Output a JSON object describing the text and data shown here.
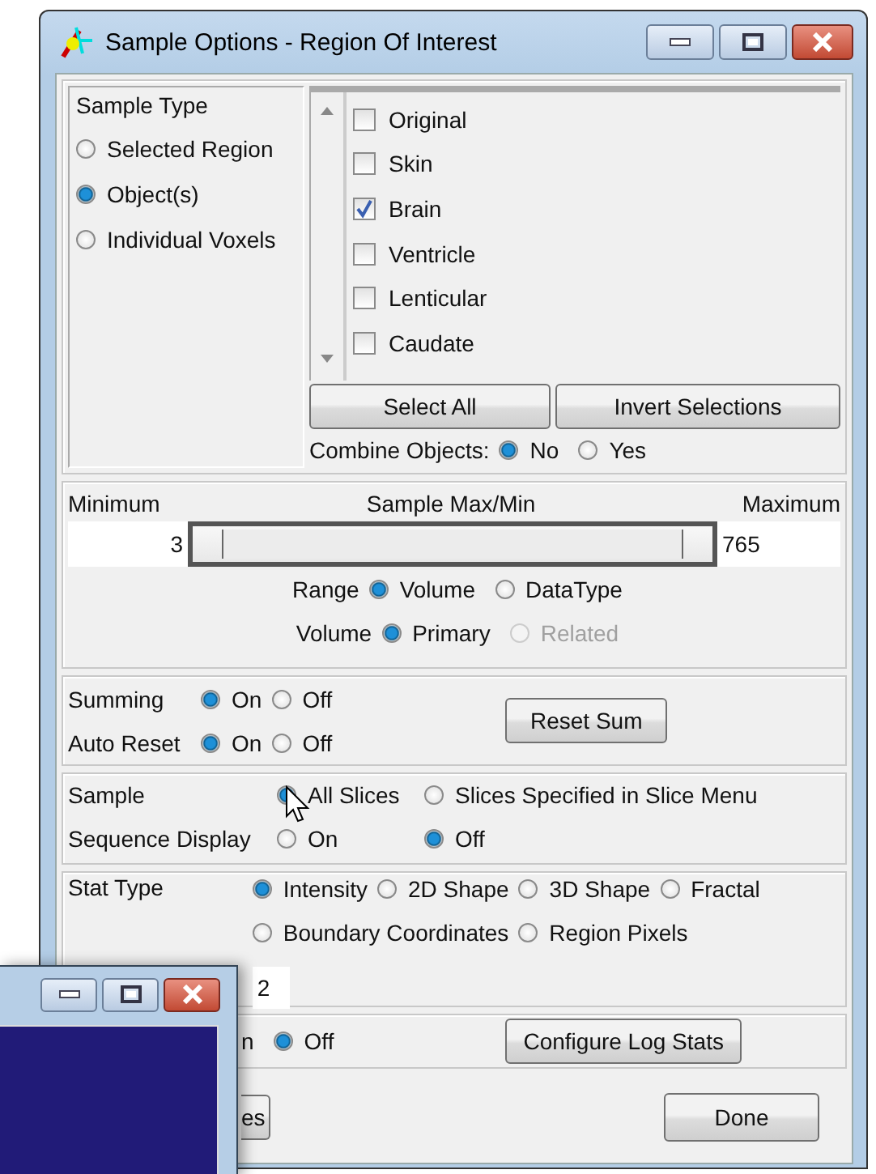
{
  "window": {
    "title": "Sample Options - Region Of Interest"
  },
  "sample_type": {
    "title": "Sample Type",
    "options": [
      {
        "label": "Selected Region",
        "selected": false
      },
      {
        "label": "Object(s)",
        "selected": true
      },
      {
        "label": "Individual Voxels",
        "selected": false
      }
    ]
  },
  "objects": {
    "items": [
      {
        "label": "Original",
        "checked": false
      },
      {
        "label": "Skin",
        "checked": false
      },
      {
        "label": "Brain",
        "checked": true
      },
      {
        "label": "Ventricle",
        "checked": false
      },
      {
        "label": "Lenticular",
        "checked": false
      },
      {
        "label": "Caudate",
        "checked": false
      }
    ],
    "buttons": [
      "Select All",
      "Invert Selections"
    ],
    "combine": {
      "label": "Combine Objects:",
      "options": [
        {
          "label": "No",
          "selected": true
        },
        {
          "label": "Yes",
          "selected": false
        }
      ]
    }
  },
  "range_panel": {
    "minimum_label": "Minimum",
    "title": "Sample Max/Min",
    "maximum_label": "Maximum",
    "minimum": "3",
    "maximum": "765",
    "slider": {
      "level": 1
    },
    "rows": [
      {
        "label": "Range",
        "options": [
          {
            "label": "Volume",
            "selected": true,
            "disabled": false
          },
          {
            "label": "DataType",
            "selected": false,
            "disabled": false
          }
        ]
      },
      {
        "label": "Volume",
        "options": [
          {
            "label": "Primary",
            "selected": true,
            "disabled": false
          },
          {
            "label": "Related",
            "selected": false,
            "disabled": true
          }
        ]
      }
    ]
  },
  "summing": {
    "rows": [
      {
        "label": "Summing",
        "options": [
          {
            "label": "On",
            "selected": true
          },
          {
            "label": "Off",
            "selected": false
          }
        ]
      },
      {
        "label": "Auto Reset",
        "options": [
          {
            "label": "On",
            "selected": true
          },
          {
            "label": "Off",
            "selected": false
          }
        ]
      }
    ],
    "button": "Reset Sum"
  },
  "sample": {
    "rows": [
      {
        "label": "Sample",
        "options": [
          {
            "label": "All Slices",
            "selected": true
          },
          {
            "label": "Slices Specified in Slice Menu",
            "selected": false
          }
        ]
      },
      {
        "label": "Sequence Display",
        "options": [
          {
            "label": "On",
            "selected": false
          },
          {
            "label": "Off",
            "selected": true
          }
        ]
      }
    ]
  },
  "stat_type": {
    "label": "Stat Type",
    "options": [
      {
        "label": "Intensity",
        "selected": true
      },
      {
        "label": "2D Shape",
        "selected": false
      },
      {
        "label": "3D Shape",
        "selected": false
      },
      {
        "label": "Fractal",
        "selected": false
      },
      {
        "label": "Boundary Coordinates",
        "selected": false
      },
      {
        "label": "Region Pixels",
        "selected": false
      }
    ],
    "value": "2"
  },
  "log": {
    "partial_label": "n",
    "options": [
      {
        "label": "Off",
        "selected": true
      }
    ],
    "button": "Configure Log Stats"
  },
  "footer": {
    "buttons": [
      "es",
      "Done"
    ]
  }
}
